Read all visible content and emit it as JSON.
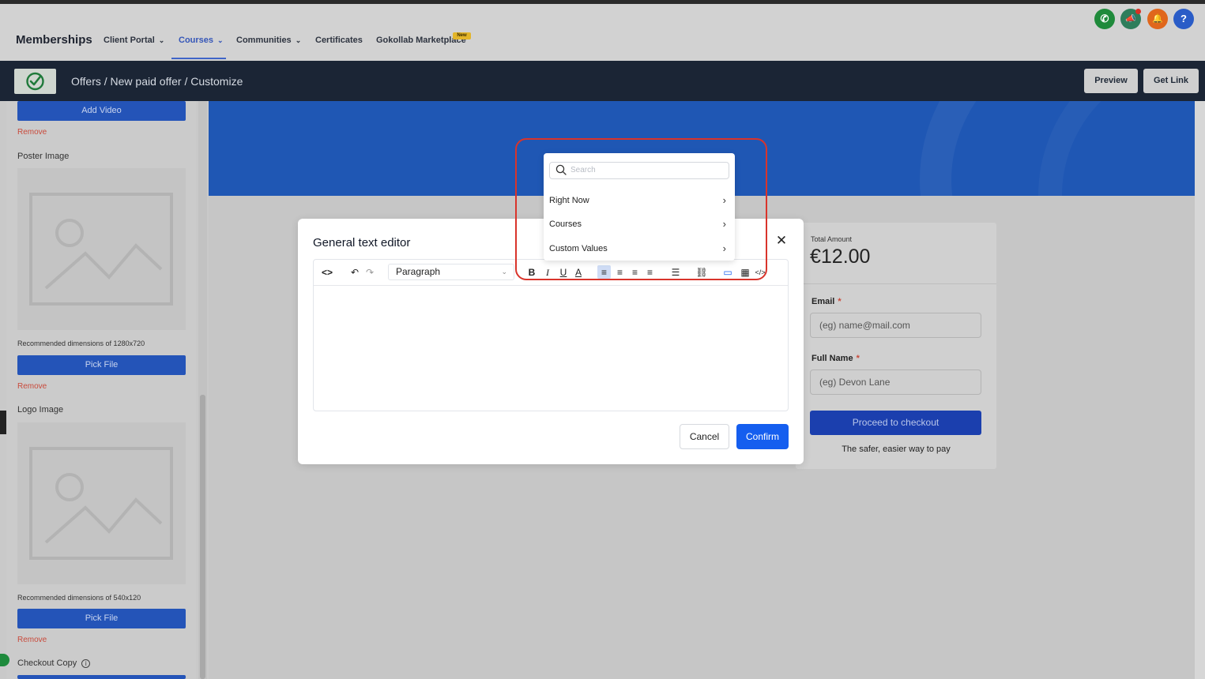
{
  "topnav": {
    "brand": "Memberships",
    "items": [
      {
        "label": "Client Portal",
        "chevron": "⌄"
      },
      {
        "label": "Courses",
        "chevron": "⌄",
        "active": true
      },
      {
        "label": "Communities",
        "chevron": "⌄"
      },
      {
        "label": "Certificates"
      },
      {
        "label": "Gokollab Marketplace",
        "badge": "New"
      }
    ],
    "icons": [
      {
        "name": "phone-icon",
        "glyph": "✆",
        "color": "#1f8a3b"
      },
      {
        "name": "megaphone-icon",
        "glyph": "📣",
        "color": "#2e7d5b"
      },
      {
        "name": "bell-icon",
        "glyph": "🔔",
        "color": "#e0671c"
      },
      {
        "name": "help-icon",
        "glyph": "?",
        "color": "#2a5cc7"
      }
    ]
  },
  "header": {
    "breadcrumb": "Offers / New paid offer / Customize",
    "preview_label": "Preview",
    "get_link_label": "Get Link"
  },
  "sidebar": {
    "add_video_label": "Add Video",
    "remove_label": "Remove",
    "poster_image_label": "Poster Image",
    "poster_dimensions": "Recommended dimensions of 1280x720",
    "pick_file_label": "Pick File",
    "logo_image_label": "Logo Image",
    "logo_dimensions": "Recommended dimensions of 540x120",
    "checkout_copy_label": "Checkout Copy",
    "info_glyph": "i"
  },
  "checkout": {
    "total_label": "Total Amount",
    "total_value": "€12.00",
    "email_label": "Email",
    "email_placeholder": "(eg) name@mail.com",
    "name_label": "Full Name",
    "name_placeholder": "(eg) Devon Lane",
    "required_mark": "*",
    "proceed_label": "Proceed to checkout",
    "safe_text": "The safer, easier way to pay"
  },
  "modal": {
    "title": "General text editor",
    "close_glyph": "✕",
    "paragraph_value": "Paragraph",
    "cancel_label": "Cancel",
    "confirm_label": "Confirm",
    "toolbar": {
      "code": "<>",
      "undo": "↶",
      "redo": "↷",
      "bold": "B",
      "italic": "I",
      "underline": "U",
      "text_color": "A",
      "align_left": "≡",
      "align_center": "≡",
      "align_right": "≡",
      "align_justify": "≡",
      "bullet_list": "☰",
      "link": "⛓",
      "custom_value": "▭",
      "table": "▦",
      "source": "</>"
    }
  },
  "dropdown": {
    "search_placeholder": "Search",
    "items": [
      "Right Now",
      "Courses",
      "Custom Values"
    ],
    "arrow": "›"
  }
}
